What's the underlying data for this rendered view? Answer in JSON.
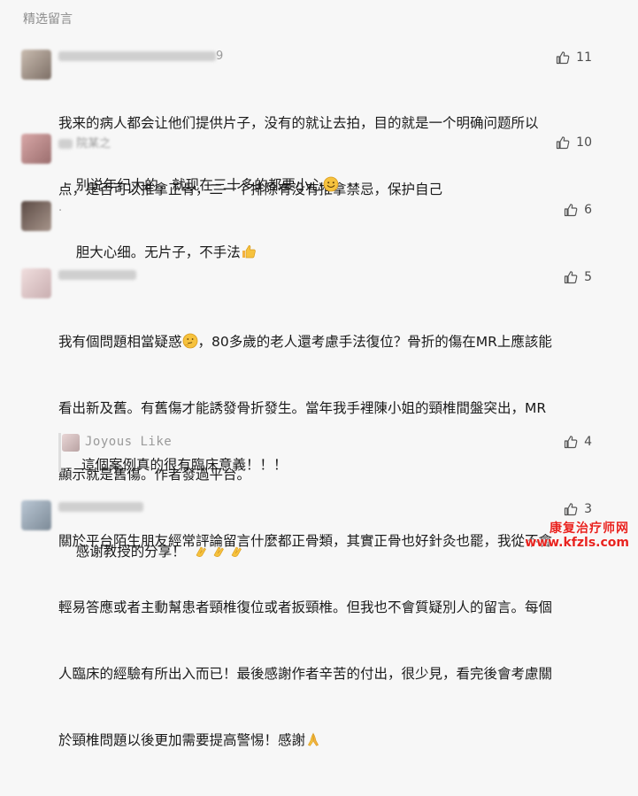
{
  "header": {
    "title": "精选留言"
  },
  "comments": [
    {
      "name_suffix": "9",
      "likes": "11",
      "text_lines": [
        "我来的病人都会让他们提供片子，没有的就让去拍，目的就是一个明确问题所以",
        "点，是否可以推拿正骨，二一个排除有没有推拿禁忌，保护自己"
      ]
    },
    {
      "name_suffix": "院某之",
      "likes": "10",
      "text": "别说年纪大的，就现在三十多的都要小心"
    },
    {
      "name_suffix": ".",
      "likes": "6",
      "text": "胆大心细。无片子，不手法"
    },
    {
      "name_suffix": "",
      "likes": "5",
      "text_line1": "我有個問題相當疑惑",
      "text_line1b": "，80多歲的老人還考慮手法復位？骨折的傷在MR上應該能",
      "text_lines": [
        "看出新及舊。有舊傷才能誘發骨折發生。當年我手裡陳小姐的頸椎間盤突出，MR",
        "顯示就是舊傷。作者發過平台。",
        "關於平台陌生朋友經常評論留言什麼都正骨類，其實正骨也好針灸也罷，我從不會",
        "輕易答應或者主動幫患者頸椎復位或者扳頸椎。但我也不會質疑別人的留言。每個",
        "人臨床的經驗有所出入而已！最後感謝作者辛苦的付出，很少見，看完後會考慮關"
      ],
      "text_last": "於頸椎問題以後更加需要提高警惕！感謝",
      "reply": {
        "name": "Joyous Like",
        "likes": "4",
        "text": "這個案例真的很有臨床意義！！！"
      }
    },
    {
      "name_suffix": "",
      "likes": "3",
      "text": "感谢教授的分享！"
    }
  ],
  "watermark": {
    "line1": "康复治疗师网",
    "line2": "www.kfzls.com"
  },
  "icons": {
    "like": "thumbs-up-icon",
    "smile": "smile-emoji",
    "thumb": "thumbs-up-emoji",
    "think": "thinking-emoji",
    "pray": "pray-emoji",
    "clap": "clap-emoji"
  }
}
